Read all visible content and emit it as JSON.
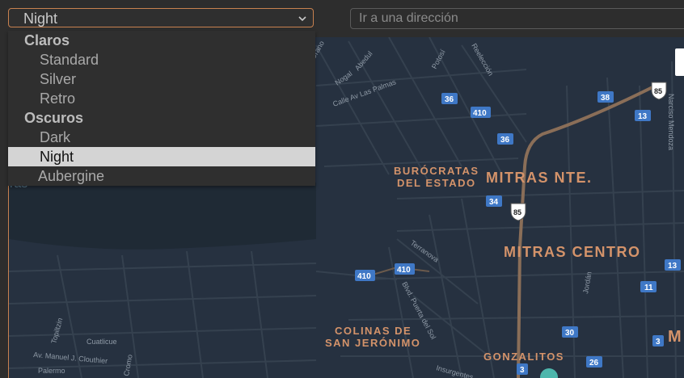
{
  "style_select": {
    "value": "Night"
  },
  "address": {
    "placeholder": "Ir a una dirección"
  },
  "dropdown": {
    "groups": [
      {
        "label": "Claros",
        "options": [
          "Standard",
          "Silver",
          "Retro"
        ]
      },
      {
        "label": "Oscuros",
        "options": [
          "Dark",
          "Night",
          "Aubergine"
        ]
      }
    ],
    "selected": "Night"
  },
  "map": {
    "partial_text": "ras",
    "areas": {
      "mitras_nte": "MITRAS NTE.",
      "mitras_centro": "MITRAS CENTRO",
      "burocratas_1": "BURÓCRATAS",
      "burocratas_2": "DEL ESTADO",
      "colinas_1": "COLINAS DE",
      "colinas_2": "SAN JERÓNIMO",
      "gonzalitos": "GONZALITOS",
      "edge_m": "M"
    },
    "streets": {
      "urano": "Urano",
      "nogal": "Nogal",
      "abedul": "Abedul",
      "potosi": "Potosí",
      "reeleccion": "Reelección",
      "las_palmas": "Calle Av Las Palmas",
      "narciso": "Narciso Mendoza",
      "terranova": "Terranova",
      "puerta_sol": "Blvd. Puerta del Sol",
      "jordan": "Jordán",
      "topilitzin": "Topiltzin",
      "cuatlicue": "Cuatlicue",
      "clouthier": "Av. Manuel J. Clouthier",
      "palermo": "Palermo",
      "cromo": "Cromo",
      "insurgentes": "Insurgentes"
    },
    "shields": [
      "36",
      "410",
      "36",
      "34",
      "38",
      "13",
      "85",
      "85",
      "410",
      "410",
      "13",
      "11",
      "30",
      "26",
      "3",
      "3"
    ],
    "colors": {
      "background": "#263140",
      "roads": "#34404e",
      "highway": "#8a6e58",
      "labels": "#d4936a",
      "shield": "#3f78c6"
    }
  }
}
